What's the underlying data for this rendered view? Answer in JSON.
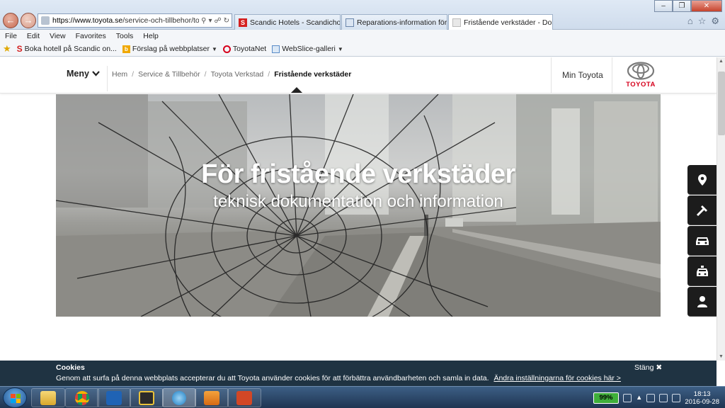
{
  "browser": {
    "address_prefix": "https://www.toyota.se",
    "address_path": "/service-och-tillbehor/toyota",
    "tabs": [
      {
        "label": "Scandic Hotels - Scandichotels...",
        "icon": "S"
      },
      {
        "label": "Reparations-information för all...",
        "icon": ""
      },
      {
        "label": "Fristående verkstäder - Dok...",
        "icon": "",
        "active": true
      }
    ],
    "menu": [
      "File",
      "Edit",
      "View",
      "Favorites",
      "Tools",
      "Help"
    ],
    "favorites": [
      {
        "label": "Boka hotell på Scandic on..."
      },
      {
        "label": "Förslag på webbplatser"
      },
      {
        "label": "ToyotaNet"
      },
      {
        "label": "WebSlice-galleri"
      }
    ]
  },
  "header": {
    "menu_label": "Meny",
    "breadcrumb": [
      "Hem",
      "Service & Tillbehör",
      "Toyota Verkstad"
    ],
    "breadcrumb_current": "Fristående verkstäder",
    "min_toyota": "Min Toyota",
    "logo_text": "TOYOTA"
  },
  "hero": {
    "title": "För fristående verkstäder",
    "subtitle": "teknisk dokumentation och information"
  },
  "side_tools": [
    "map-pin-icon",
    "hammer-icon",
    "car-icon",
    "taxi-icon",
    "person-icon"
  ],
  "cookie": {
    "title": "Cookies",
    "text": "Genom att surfa på denna webbplats accepterar du att Toyota använder cookies för att förbättra användbarheten och samla in data.",
    "link": "Ändra inställningarna för cookies här >",
    "close": "Stäng ✖"
  },
  "taskbar": {
    "battery": "99%",
    "time": "18:13",
    "date": "2016-09-28"
  },
  "colors": {
    "toyota_red": "#d6001c",
    "cookie_bg": "#1f3342",
    "tool_bg": "#1c1c1c"
  }
}
